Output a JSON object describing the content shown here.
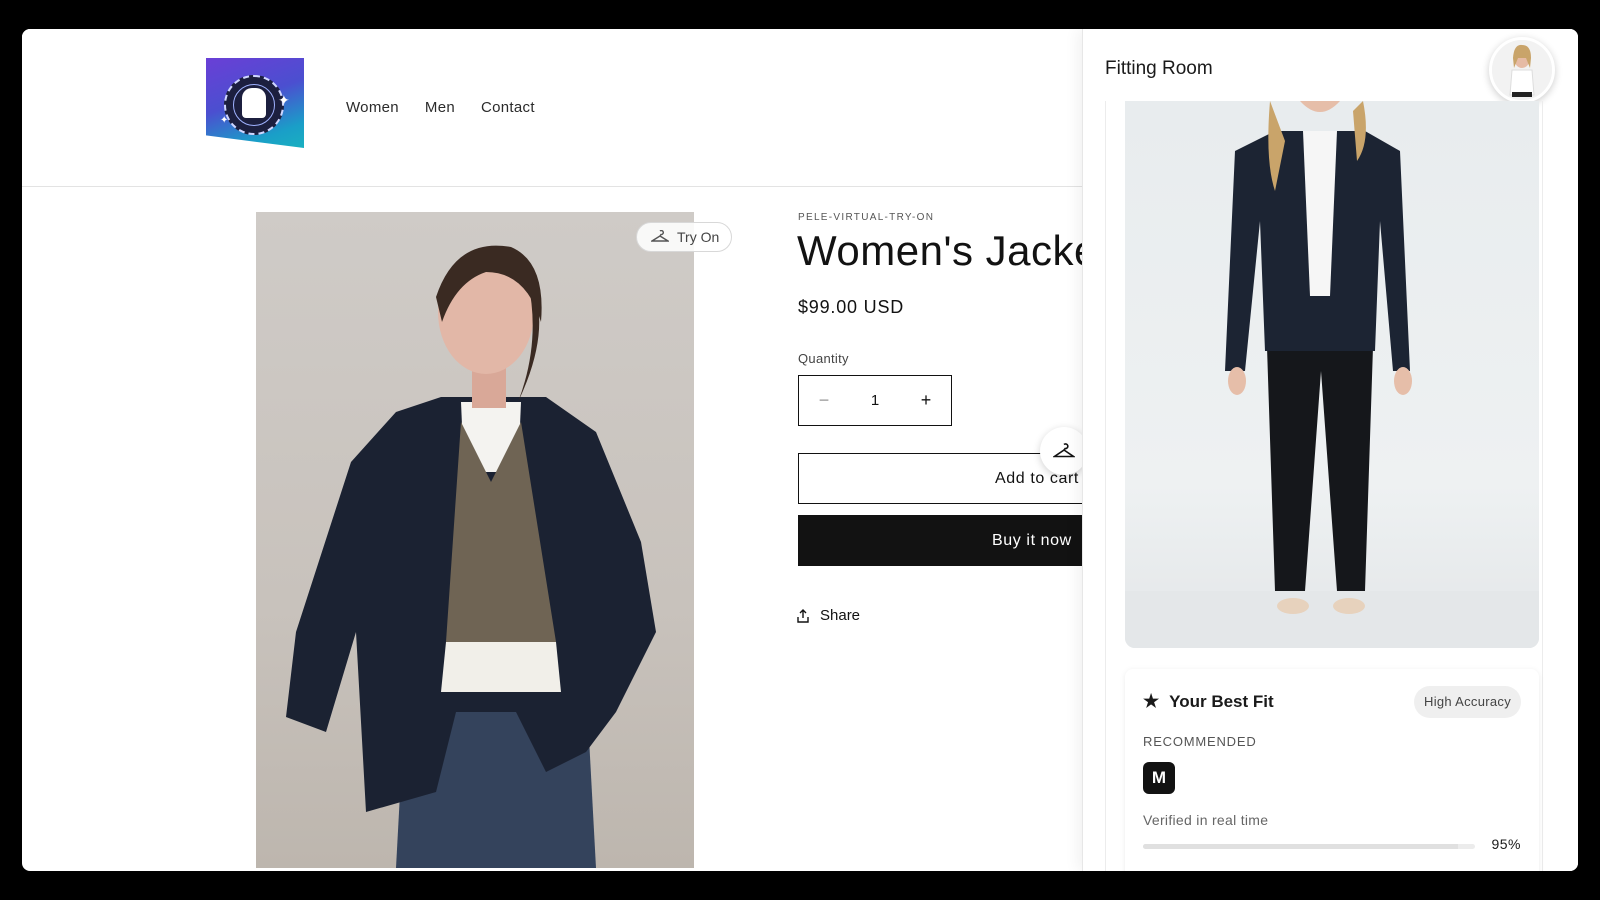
{
  "header": {
    "nav": [
      "Women",
      "Men",
      "Contact"
    ]
  },
  "product": {
    "try_on_label": "Try On",
    "vendor": "PELE-VIRTUAL-TRY-ON",
    "title": "Women's Jacke",
    "price": "$99.00 USD",
    "quantity_label": "Quantity",
    "quantity_value": "1",
    "add_to_cart_label": "Add to cart",
    "buy_now_label": "Buy it now",
    "share_label": "Share"
  },
  "fitting_room": {
    "title": "Fitting Room",
    "best_fit_title": "Your Best Fit",
    "accuracy_badge": "High Accuracy",
    "recommended_label": "RECOMMENDED",
    "recommended_size": "M",
    "verified_label": "Verified in real time",
    "confidence_pct": "95%",
    "confidence_value": 0.95
  },
  "icons": {
    "try_on": "hanger-icon",
    "share": "share-icon",
    "fab": "hanger-icon",
    "best_fit": "star-icon"
  },
  "colors": {
    "primary": "#121212",
    "badge_bg": "#efefef"
  }
}
